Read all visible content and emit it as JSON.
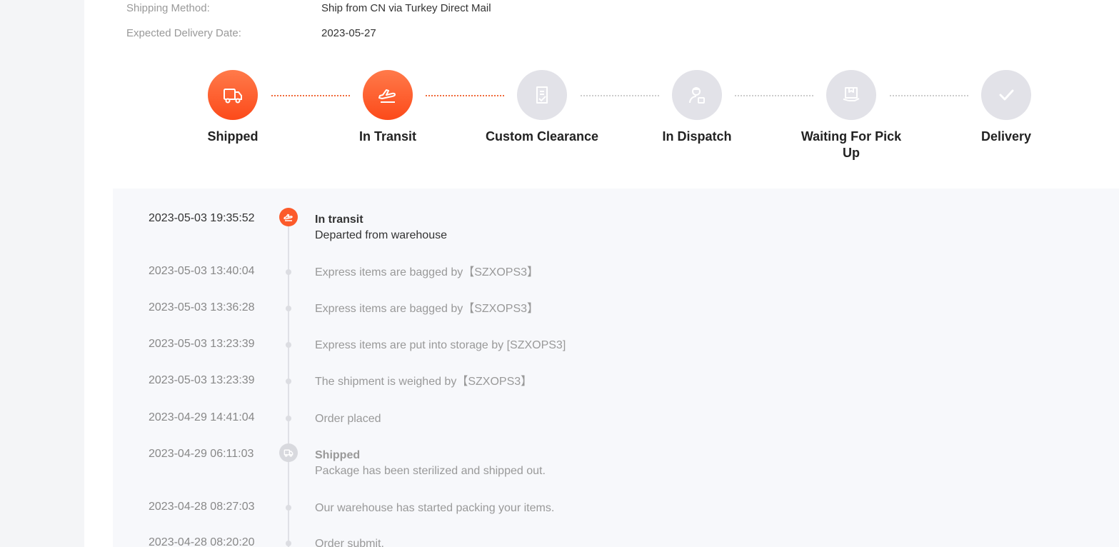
{
  "shipping_info": {
    "method_label": "Shipping Method:",
    "method_value": "Ship from CN via Turkey Direct Mail",
    "delivery_label": "Expected Delivery Date:",
    "delivery_value": "2023-05-27"
  },
  "steps": [
    {
      "label": "Shipped",
      "icon": "truck-icon",
      "status": "active"
    },
    {
      "label": "In Transit",
      "icon": "airplane-icon",
      "status": "active"
    },
    {
      "label": "Custom Clearance",
      "icon": "clipboard-check-icon",
      "status": "inactive"
    },
    {
      "label": "In Dispatch",
      "icon": "courier-icon",
      "status": "inactive"
    },
    {
      "label": "Waiting For Pick Up",
      "icon": "package-icon",
      "status": "inactive"
    },
    {
      "label": "Delivery",
      "icon": "checkmark-icon",
      "status": "inactive"
    }
  ],
  "events": [
    {
      "time": "2023-05-03 19:35:52",
      "title": "In transit",
      "desc": "Departed from warehouse",
      "icon": "airplane-icon",
      "current": true
    },
    {
      "time": "2023-05-03 13:40:04",
      "title": "",
      "desc": "Express items are bagged by【SZXOPS3】"
    },
    {
      "time": "2023-05-03 13:36:28",
      "title": "",
      "desc": "Express items are bagged by【SZXOPS3】"
    },
    {
      "time": "2023-05-03 13:23:39",
      "title": "",
      "desc": "Express items are put into storage by [SZXOPS3]"
    },
    {
      "time": "2023-05-03 13:23:39",
      "title": "",
      "desc": "The shipment is weighed by【SZXOPS3】"
    },
    {
      "time": "2023-04-29 14:41:04",
      "title": "",
      "desc": "Order placed"
    },
    {
      "time": "2023-04-29 06:11:03",
      "title": "Shipped",
      "desc": "Package has been sterilized and shipped out.",
      "icon": "truck-icon"
    },
    {
      "time": "2023-04-28 08:27:03",
      "title": "",
      "desc": "Our warehouse has started packing your items."
    },
    {
      "time": "2023-04-28 08:20:20",
      "title": "",
      "desc": "Order submit."
    }
  ],
  "colors": {
    "accent": "#fc4a1a",
    "inactive": "#e2e2e8"
  }
}
